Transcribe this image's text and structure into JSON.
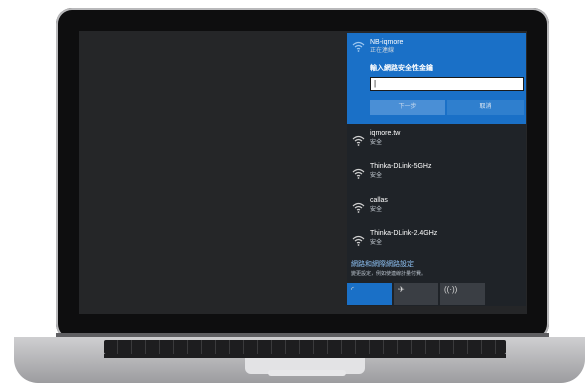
{
  "flyout": {
    "selected_network": {
      "name": "NB-iqmore",
      "status": "正在連線"
    },
    "password_prompt": {
      "label": "輸入網路安全性金鑰",
      "value": "|"
    },
    "buttons": {
      "next": "下一步",
      "cancel": "取消"
    },
    "networks": [
      {
        "name": "iqmore.tw",
        "status": "安全"
      },
      {
        "name": "Thinka-DLink-5GHz",
        "status": "安全"
      },
      {
        "name": "callas",
        "status": "安全"
      },
      {
        "name": "Thinka-DLink-2.4GHz",
        "status": "安全"
      }
    ],
    "settings_link": {
      "label": "網路和網際網路設定",
      "sub": "變更設定，例如使連線計量付費。"
    },
    "quick_actions": [
      {
        "name": "wifi",
        "icon": "wifi-icon"
      },
      {
        "name": "airplane",
        "icon": "airplane-icon"
      },
      {
        "name": "hotspot",
        "icon": "hotspot-icon"
      }
    ]
  },
  "colors": {
    "accent": "#1a70c7",
    "flyout_bg": "#1f2328",
    "desktop": "#252628"
  }
}
